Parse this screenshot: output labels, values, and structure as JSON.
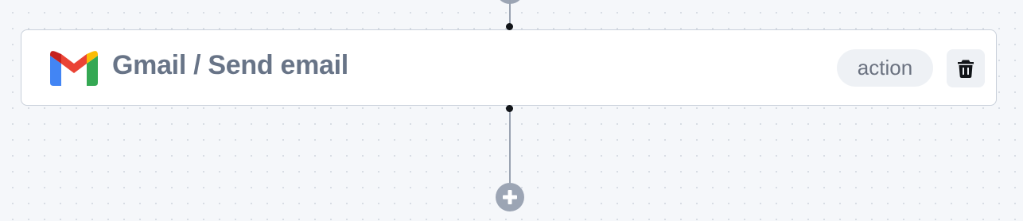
{
  "node": {
    "title": "Gmail / Send email",
    "badge": "action",
    "app_icon": "gmail-logo",
    "delete_icon": "trash-icon"
  },
  "add_step": {
    "icon": "plus-icon"
  },
  "colors": {
    "canvas_background": "#f5f7fa",
    "card_border": "#c9d0da",
    "title_text": "#687487",
    "badge_background": "#eef1f5",
    "connector": "#9aa3b1",
    "add_button": "#9ca5b4",
    "gmail_red": "#ea4335",
    "gmail_blue": "#4285f4",
    "gmail_green": "#34a853",
    "gmail_yellow": "#fbbc04"
  }
}
